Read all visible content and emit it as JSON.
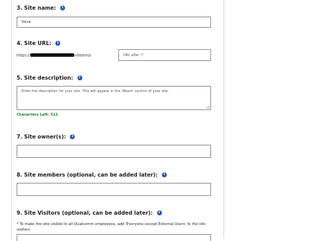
{
  "form": {
    "site_name": {
      "label": "3. Site name:",
      "value": "Value"
    },
    "site_url": {
      "label": "4. Site URL:",
      "prefix_start": "https://",
      "prefix_end": "n/teams/",
      "placeholder": "URL after '/'"
    },
    "site_description": {
      "label": "5. Site description:",
      "placeholder": "Enter the description for your site. This will appear in the 'About' section of your site.",
      "characters_left": "Characters Left: 512"
    },
    "site_owners": {
      "label": "7. Site owner(s):"
    },
    "site_members": {
      "label": "8. Site members (optional, can be added later):"
    },
    "site_visitors": {
      "label": "9. Site Visitors (optional, can be added later):",
      "note": "* To make the site visible to all Qualcomm employees, add 'Everyone except External Users' to the site visitors."
    }
  },
  "icons": {
    "info": "info-icon"
  },
  "colors": {
    "info_icon": "#2451b5",
    "counter_text": "#1a7f36"
  }
}
